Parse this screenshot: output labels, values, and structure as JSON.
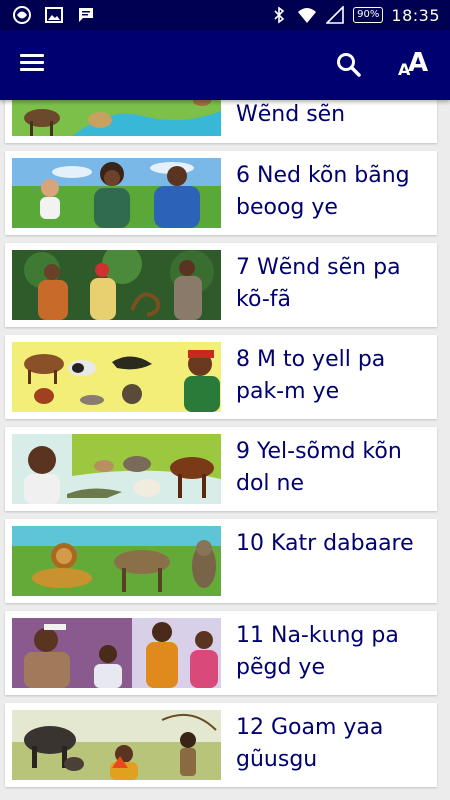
{
  "status_bar": {
    "time": "18:35",
    "battery": "90%"
  },
  "app_bar": {
    "textsize_small": "A",
    "textsize_large": "A"
  },
  "chapters": [
    {
      "title": "Wẽnd sẽn"
    },
    {
      "title": "6 Ned kõn bãng beoog ye"
    },
    {
      "title": "7 Wẽnd sẽn pa kõ-fã"
    },
    {
      "title": "8 M to yell pa pak-m ye"
    },
    {
      "title": "9 Yel-sõmd kõn dol ne"
    },
    {
      "title": "10 Katr dabaare"
    },
    {
      "title": "11 Na-kɩɩng pa pẽgd ye"
    },
    {
      "title": "12 Goam yaa gũusgu"
    }
  ]
}
